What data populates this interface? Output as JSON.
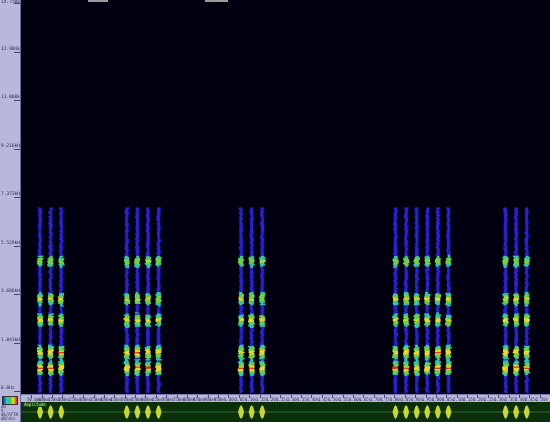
{
  "freq_ruler": {
    "labels": [
      "14.750k",
      "12.904k",
      "11.060k",
      "9.216kHz",
      "7.373kHz",
      "5.529kHz",
      "3.686kHz",
      "1.843kHz",
      "0.0Hz"
    ]
  },
  "time_ruler": {
    "labels": [
      "50.0ms",
      "100ms",
      "150ms",
      "200ms",
      "250ms",
      "300ms",
      "350ms",
      "400ms",
      "450ms",
      "500ms",
      "550ms",
      "600ms",
      "650ms",
      "700ms",
      "750ms",
      "800ms",
      "850ms",
      "900ms",
      "950ms",
      "1.00s",
      "1.05s",
      "1.10s",
      "1.15s",
      "1.20s",
      "1.25s",
      "1.30s",
      "1.35s",
      "1.40s",
      "1.45s",
      "1.50s",
      "1.55s",
      "1.60s",
      "1.65s",
      "1.70s",
      "1.75s",
      "1.80s",
      "1.85s",
      "1.90s",
      "1.95s",
      "2.00s",
      "2.05s",
      "2.10s",
      "2.15s",
      "2.20s",
      "2.25s",
      "2.30s",
      "2.35s",
      "2.40s",
      "2.45s",
      "2.50s"
    ]
  },
  "corner_panel": {
    "labels": [
      "dB",
      "V.",
      "db/ATTN",
      "dB/div"
    ]
  },
  "amplitude_panel": {
    "label": "Amplitude"
  },
  "colors": {
    "background": "#000010",
    "ruler": "#b9b8dc",
    "amplitude_bg": "#0b2f0b",
    "amplitude_wave": "#c8d830",
    "heat_low": "#2a20d8",
    "heat_mid": "#28c8b0",
    "heat_midhigh": "#70d040",
    "heat_high": "#e8d820",
    "heat_peak": "#e02a18"
  },
  "chart_data": {
    "type": "heatmap",
    "description_units": "time (s) vs frequency (kHz)",
    "call_groups": [
      {
        "pulses": [
          0.09,
          0.14,
          0.19
        ]
      },
      {
        "pulses": [
          0.5,
          0.55,
          0.6,
          0.65
        ]
      },
      {
        "pulses": [
          1.04,
          1.09,
          1.14
        ]
      },
      {
        "pulses": [
          1.77,
          1.82,
          1.87,
          1.92,
          1.97,
          2.02
        ]
      },
      {
        "pulses": [
          2.29,
          2.34,
          2.39
        ]
      }
    ],
    "pulse_frequency_range_khz": [
      0.1,
      7.0
    ],
    "energy_bands_khz": [
      1.0,
      1.6,
      2.8,
      3.6,
      5.0
    ],
    "ylim": [
      0,
      14.75
    ],
    "xlim": [
      0,
      2.5
    ]
  }
}
